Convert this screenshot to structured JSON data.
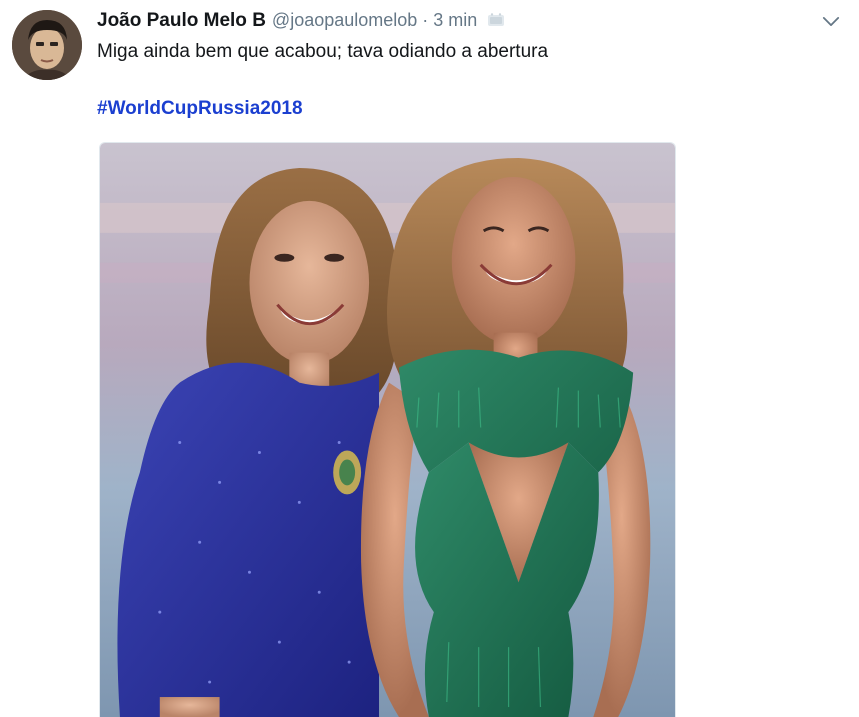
{
  "tweet": {
    "author": {
      "name": "João Paulo Melo B",
      "handle": "@joaopaulomelob",
      "avatar_icon": "user-avatar"
    },
    "separator": "·",
    "time": "3 min",
    "source_icon": "app-icon",
    "menu_icon": "chevron-down-icon",
    "text": "Miga ainda bem que acabou; tava odiando a abertura",
    "hashtag": "#WorldCupRussia2018",
    "media": {
      "description_icon": "photo-image"
    }
  },
  "colors": {
    "hashtag": "#1b3fd0",
    "secondary_text": "#657786",
    "primary_text": "#14171a"
  }
}
